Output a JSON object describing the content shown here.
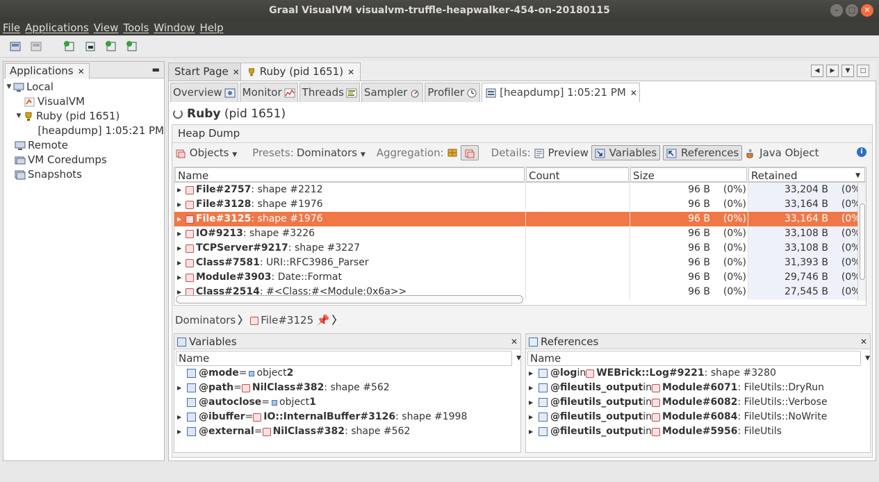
{
  "window": {
    "title": "Graal VisualVM visualvm-truffle-heapwalker-454-on-20180115"
  },
  "menu": [
    "File",
    "Applications",
    "View",
    "Tools",
    "Window",
    "Help"
  ],
  "apps": {
    "tab_label": "Applications",
    "tree": [
      {
        "label": "Local",
        "level": 0,
        "expanded": true
      },
      {
        "label": "VisualVM",
        "level": 1
      },
      {
        "label": "Ruby (pid 1651)",
        "level": 1,
        "expanded": true
      },
      {
        "label": "[heapdump] 1:05:21 PM",
        "level": 2
      },
      {
        "label": "Remote",
        "level": 0
      },
      {
        "label": "VM Coredumps",
        "level": 0
      },
      {
        "label": "Snapshots",
        "level": 0
      }
    ]
  },
  "main_tabs": [
    {
      "label": "Start Page"
    },
    {
      "label": "Ruby (pid 1651)"
    }
  ],
  "sub_tabs": [
    {
      "label": "Overview"
    },
    {
      "label": "Monitor"
    },
    {
      "label": "Threads"
    },
    {
      "label": "Sampler"
    },
    {
      "label": "Profiler"
    },
    {
      "label": "[heapdump] 1:05:21 PM"
    }
  ],
  "page": {
    "title_bold": "Ruby",
    "title_rest": " (pid 1651)"
  },
  "heap": {
    "label": "Heap Dump",
    "objects_label": "Objects",
    "presets_label": "Presets:",
    "presets_value": "Dominators",
    "aggregation_label": "Aggregation:",
    "details_label": "Details:",
    "preview_label": "Preview",
    "variables_label": "Variables",
    "references_label": "References",
    "java_object_label": "Java Object"
  },
  "grid": {
    "columns": [
      "Name",
      "Count",
      "Size",
      "Retained"
    ],
    "rows": [
      {
        "name": "File#2757",
        "desc": " : shape #2212",
        "size": "96 B",
        "size_pct": "(0%)",
        "ret": "33,204 B",
        "ret_pct": "(0%)"
      },
      {
        "name": "File#3128",
        "desc": " : shape #1976",
        "size": "96 B",
        "size_pct": "(0%)",
        "ret": "33,164 B",
        "ret_pct": "(0%)"
      },
      {
        "name": "File#3125",
        "desc": " : shape #1976",
        "size": "96 B",
        "size_pct": "(0%)",
        "ret": "33,164 B",
        "ret_pct": "(0%)",
        "selected": true
      },
      {
        "name": "IO#9213",
        "desc": " : shape #3226",
        "size": "96 B",
        "size_pct": "(0%)",
        "ret": "33,108 B",
        "ret_pct": "(0%)"
      },
      {
        "name": "TCPServer#9217",
        "desc": " : shape #3227",
        "size": "96 B",
        "size_pct": "(0%)",
        "ret": "33,108 B",
        "ret_pct": "(0%)"
      },
      {
        "name": "Class#7581",
        "desc": " : URI::RFC3986_Parser",
        "size": "96 B",
        "size_pct": "(0%)",
        "ret": "31,393 B",
        "ret_pct": "(0%)"
      },
      {
        "name": "Module#3903",
        "desc": " : Date::Format",
        "size": "96 B",
        "size_pct": "(0%)",
        "ret": "29,746 B",
        "ret_pct": "(0%)"
      },
      {
        "name": "Class#2514",
        "desc": " : #<Class:#<Module:0x6a>>",
        "size": "96 B",
        "size_pct": "(0%)",
        "ret": "27,545 B",
        "ret_pct": "(0%)"
      }
    ]
  },
  "crumbs": {
    "root": "Dominators",
    "item": "File#3125"
  },
  "variables": {
    "title": "Variables",
    "col": "Name",
    "rows": [
      {
        "name": "@mode",
        "eq": " = ",
        "val": "object ",
        "valb": "2",
        "kind": "prim"
      },
      {
        "name": "@path",
        "eq": " = ",
        "valb": "NilClass#382",
        "val": " : shape #562",
        "kind": "obj",
        "arrow": true
      },
      {
        "name": "@autoclose",
        "eq": " = ",
        "val": "object ",
        "valb": "1",
        "kind": "prim"
      },
      {
        "name": "@ibuffer",
        "eq": " = ",
        "valb": "IO::InternalBuffer#3126",
        "val": " : shape #1998",
        "kind": "obj",
        "arrow": true
      },
      {
        "name": "@external",
        "eq": " = ",
        "valb": "NilClass#382",
        "val": " : shape #562",
        "kind": "obj",
        "arrow": true
      }
    ]
  },
  "references": {
    "title": "References",
    "col": "Name",
    "rows": [
      {
        "name": "@log",
        "in": " in ",
        "ownerb": "WEBrick::Log#9221",
        "owner": " : shape #3280"
      },
      {
        "name": "@fileutils_output",
        "in": " in ",
        "ownerb": "Module#6071",
        "owner": " : FileUtils::DryRun"
      },
      {
        "name": "@fileutils_output",
        "in": " in ",
        "ownerb": "Module#6082",
        "owner": " : FileUtils::Verbose"
      },
      {
        "name": "@fileutils_output",
        "in": " in ",
        "ownerb": "Module#6084",
        "owner": " : FileUtils::NoWrite"
      },
      {
        "name": "@fileutils_output",
        "in": " in ",
        "ownerb": "Module#5956",
        "owner": " : FileUtils"
      }
    ]
  },
  "colors": {
    "selection": "#f07746",
    "accent": "#2f6fc0"
  }
}
